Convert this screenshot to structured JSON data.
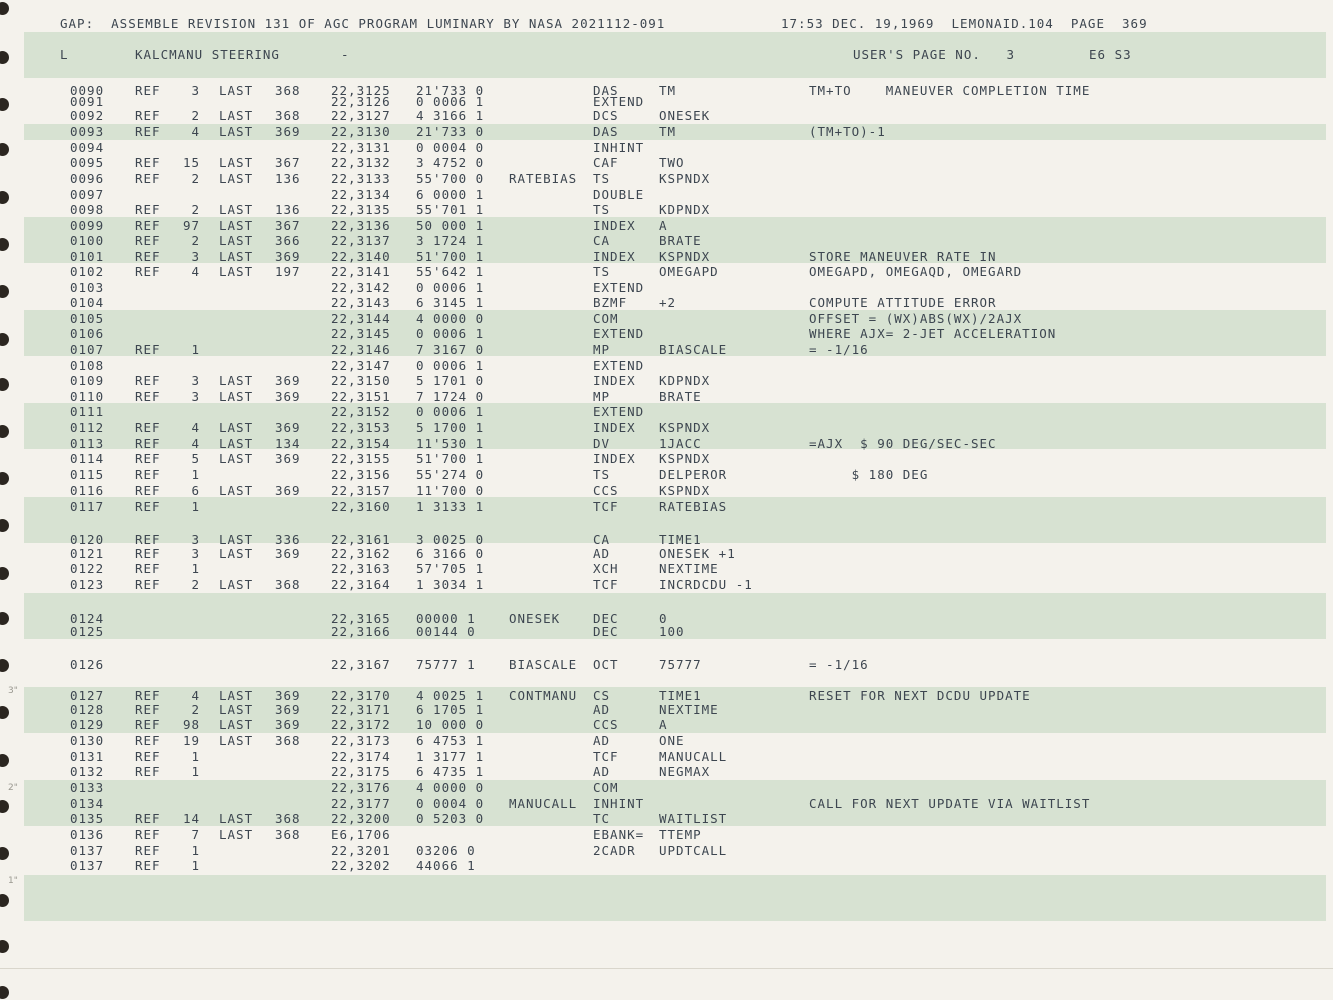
{
  "header": {
    "left": "GAP:  ASSEMBLE REVISION 131 OF AGC PROGRAM LUMINARY BY NASA 2021112-091",
    "right": "17:53 DEC. 19,1969  LEMONAID.104  PAGE  369"
  },
  "subheader": {
    "type": "L",
    "title": "KALCMANU STEERING",
    "dash": "-",
    "users_page": "USER'S PAGE NO.   3",
    "bank": "E6 S3"
  },
  "rows": [
    {
      "line": "0090",
      "ref": "REF",
      "refnum": "3",
      "last": "LAST",
      "lastpage": "368",
      "loc": "22,3125",
      "word": "21'733 0",
      "label": "",
      "op": "DAS",
      "operand": "TM",
      "comment": "TM+TO    MANEUVER COMPLETION TIME"
    },
    {
      "line": "0091",
      "ref": "",
      "refnum": "",
      "last": "",
      "lastpage": "",
      "loc": "22,3126",
      "word": "0 0006 1",
      "label": "",
      "op": "EXTEND",
      "operand": "",
      "comment": ""
    },
    {
      "line": "0092",
      "ref": "REF",
      "refnum": "2",
      "last": "LAST",
      "lastpage": "368",
      "loc": "22,3127",
      "word": "4 3166 1",
      "label": "",
      "op": "DCS",
      "operand": "ONESEK",
      "comment": ""
    },
    {
      "line": "0093",
      "ref": "REF",
      "refnum": "4",
      "last": "LAST",
      "lastpage": "369",
      "loc": "22,3130",
      "word": "21'733 0",
      "label": "",
      "op": "DAS",
      "operand": "TM",
      "comment": "(TM+TO)-1"
    },
    {
      "line": "0094",
      "ref": "",
      "refnum": "",
      "last": "",
      "lastpage": "",
      "loc": "22,3131",
      "word": "0 0004 0",
      "label": "",
      "op": "INHINT",
      "operand": "",
      "comment": ""
    },
    {
      "line": "0095",
      "ref": "REF",
      "refnum": "15",
      "last": "LAST",
      "lastpage": "367",
      "loc": "22,3132",
      "word": "3 4752 0",
      "label": "",
      "op": "CAF",
      "operand": "TWO",
      "comment": ""
    },
    {
      "line": "0096",
      "ref": "REF",
      "refnum": "2",
      "last": "LAST",
      "lastpage": "136",
      "loc": "22,3133",
      "word": "55'700 0",
      "label": "RATEBIAS",
      "op": "TS",
      "operand": "KSPNDX",
      "comment": ""
    },
    {
      "line": "0097",
      "ref": "",
      "refnum": "",
      "last": "",
      "lastpage": "",
      "loc": "22,3134",
      "word": "6 0000 1",
      "label": "",
      "op": "DOUBLE",
      "operand": "",
      "comment": ""
    },
    {
      "line": "0098",
      "ref": "REF",
      "refnum": "2",
      "last": "LAST",
      "lastpage": "136",
      "loc": "22,3135",
      "word": "55'701 1",
      "label": "",
      "op": "TS",
      "operand": "KDPNDX",
      "comment": ""
    },
    {
      "line": "0099",
      "ref": "REF",
      "refnum": "97",
      "last": "LAST",
      "lastpage": "367",
      "loc": "22,3136",
      "word": "50 000 1",
      "label": "",
      "op": "INDEX",
      "operand": "A",
      "comment": ""
    },
    {
      "line": "0100",
      "ref": "REF",
      "refnum": "2",
      "last": "LAST",
      "lastpage": "366",
      "loc": "22,3137",
      "word": "3 1724 1",
      "label": "",
      "op": "CA",
      "operand": "BRATE",
      "comment": ""
    },
    {
      "line": "0101",
      "ref": "REF",
      "refnum": "3",
      "last": "LAST",
      "lastpage": "369",
      "loc": "22,3140",
      "word": "51'700 1",
      "label": "",
      "op": "INDEX",
      "operand": "KSPNDX",
      "comment": "STORE MANEUVER RATE IN"
    },
    {
      "line": "0102",
      "ref": "REF",
      "refnum": "4",
      "last": "LAST",
      "lastpage": "197",
      "loc": "22,3141",
      "word": "55'642 1",
      "label": "",
      "op": "TS",
      "operand": "OMEGAPD",
      "comment": "OMEGAPD, OMEGAQD, OMEGARD"
    },
    {
      "line": "0103",
      "ref": "",
      "refnum": "",
      "last": "",
      "lastpage": "",
      "loc": "22,3142",
      "word": "0 0006 1",
      "label": "",
      "op": "EXTEND",
      "operand": "",
      "comment": ""
    },
    {
      "line": "0104",
      "ref": "",
      "refnum": "",
      "last": "",
      "lastpage": "",
      "loc": "22,3143",
      "word": "6 3145 1",
      "label": "",
      "op": "BZMF",
      "operand": "+2",
      "comment": "COMPUTE ATTITUDE ERROR"
    },
    {
      "line": "0105",
      "ref": "",
      "refnum": "",
      "last": "",
      "lastpage": "",
      "loc": "22,3144",
      "word": "4 0000 0",
      "label": "",
      "op": "COM",
      "operand": "",
      "comment": "OFFSET = (WX)ABS(WX)/2AJX"
    },
    {
      "line": "0106",
      "ref": "",
      "refnum": "",
      "last": "",
      "lastpage": "",
      "loc": "22,3145",
      "word": "0 0006 1",
      "label": "",
      "op": "EXTEND",
      "operand": "",
      "comment": "WHERE AJX= 2-JET ACCELERATION"
    },
    {
      "line": "0107",
      "ref": "REF",
      "refnum": "1",
      "last": "",
      "lastpage": "",
      "loc": "22,3146",
      "word": "7 3167 0",
      "label": "",
      "op": "MP",
      "operand": "BIASCALE",
      "comment": "= -1/16"
    },
    {
      "line": "0108",
      "ref": "",
      "refnum": "",
      "last": "",
      "lastpage": "",
      "loc": "22,3147",
      "word": "0 0006 1",
      "label": "",
      "op": "EXTEND",
      "operand": "",
      "comment": ""
    },
    {
      "line": "0109",
      "ref": "REF",
      "refnum": "3",
      "last": "LAST",
      "lastpage": "369",
      "loc": "22,3150",
      "word": "5 1701 0",
      "label": "",
      "op": "INDEX",
      "operand": "KDPNDX",
      "comment": ""
    },
    {
      "line": "0110",
      "ref": "REF",
      "refnum": "3",
      "last": "LAST",
      "lastpage": "369",
      "loc": "22,3151",
      "word": "7 1724 0",
      "label": "",
      "op": "MP",
      "operand": "BRATE",
      "comment": ""
    },
    {
      "line": "0111",
      "ref": "",
      "refnum": "",
      "last": "",
      "lastpage": "",
      "loc": "22,3152",
      "word": "0 0006 1",
      "label": "",
      "op": "EXTEND",
      "operand": "",
      "comment": ""
    },
    {
      "line": "0112",
      "ref": "REF",
      "refnum": "4",
      "last": "LAST",
      "lastpage": "369",
      "loc": "22,3153",
      "word": "5 1700 1",
      "label": "",
      "op": "INDEX",
      "operand": "KSPNDX",
      "comment": ""
    },
    {
      "line": "0113",
      "ref": "REF",
      "refnum": "4",
      "last": "LAST",
      "lastpage": "134",
      "loc": "22,3154",
      "word": "11'530 1",
      "label": "",
      "op": "DV",
      "operand": "1JACC",
      "comment": "=AJX  $ 90 DEG/SEC-SEC"
    },
    {
      "line": "0114",
      "ref": "REF",
      "refnum": "5",
      "last": "LAST",
      "lastpage": "369",
      "loc": "22,3155",
      "word": "51'700 1",
      "label": "",
      "op": "INDEX",
      "operand": "KSPNDX",
      "comment": ""
    },
    {
      "line": "0115",
      "ref": "REF",
      "refnum": "1",
      "last": "",
      "lastpage": "",
      "loc": "22,3156",
      "word": "55'274 0",
      "label": "",
      "op": "TS",
      "operand": "DELPEROR",
      "comment": "     $ 180 DEG"
    },
    {
      "line": "0116",
      "ref": "REF",
      "refnum": "6",
      "last": "LAST",
      "lastpage": "369",
      "loc": "22,3157",
      "word": "11'700 0",
      "label": "",
      "op": "CCS",
      "operand": "KSPNDX",
      "comment": ""
    },
    {
      "line": "0117",
      "ref": "REF",
      "refnum": "1",
      "last": "",
      "lastpage": "",
      "loc": "22,3160",
      "word": "1 3133 1",
      "label": "",
      "op": "TCF",
      "operand": "RATEBIAS",
      "comment": ""
    },
    {
      "line": "0120",
      "ref": "REF",
      "refnum": "3",
      "last": "LAST",
      "lastpage": "336",
      "loc": "22,3161",
      "word": "3 0025 0",
      "label": "",
      "op": "CA",
      "operand": "TIME1",
      "comment": ""
    },
    {
      "line": "0121",
      "ref": "REF",
      "refnum": "3",
      "last": "LAST",
      "lastpage": "369",
      "loc": "22,3162",
      "word": "6 3166 0",
      "label": "",
      "op": "AD",
      "operand": "ONESEK +1",
      "comment": ""
    },
    {
      "line": "0122",
      "ref": "REF",
      "refnum": "1",
      "last": "",
      "lastpage": "",
      "loc": "22,3163",
      "word": "57'705 1",
      "label": "",
      "op": "XCH",
      "operand": "NEXTIME",
      "comment": ""
    },
    {
      "line": "0123",
      "ref": "REF",
      "refnum": "2",
      "last": "LAST",
      "lastpage": "368",
      "loc": "22,3164",
      "word": "1 3034 1",
      "label": "",
      "op": "TCF",
      "operand": "INCRDCDU -1",
      "comment": ""
    },
    {
      "line": "0124",
      "ref": "",
      "refnum": "",
      "last": "",
      "lastpage": "",
      "loc": "22,3165",
      "word": "00000 1",
      "label": "ONESEK",
      "op": "DEC",
      "operand": "0",
      "comment": ""
    },
    {
      "line": "0125",
      "ref": "",
      "refnum": "",
      "last": "",
      "lastpage": "",
      "loc": "22,3166",
      "word": "00144 0",
      "label": "",
      "op": "DEC",
      "operand": "100",
      "comment": ""
    },
    {
      "line": "0126",
      "ref": "",
      "refnum": "",
      "last": "",
      "lastpage": "",
      "loc": "22,3167",
      "word": "75777 1",
      "label": "BIASCALE",
      "op": "OCT",
      "operand": "75777",
      "comment": "= -1/16"
    },
    {
      "line": "0127",
      "ref": "REF",
      "refnum": "4",
      "last": "LAST",
      "lastpage": "369",
      "loc": "22,3170",
      "word": "4 0025 1",
      "label": "CONTMANU",
      "op": "CS",
      "operand": "TIME1",
      "comment": "RESET FOR NEXT DCDU UPDATE"
    },
    {
      "line": "0128",
      "ref": "REF",
      "refnum": "2",
      "last": "LAST",
      "lastpage": "369",
      "loc": "22,3171",
      "word": "6 1705 1",
      "label": "",
      "op": "AD",
      "operand": "NEXTIME",
      "comment": ""
    },
    {
      "line": "0129",
      "ref": "REF",
      "refnum": "98",
      "last": "LAST",
      "lastpage": "369",
      "loc": "22,3172",
      "word": "10 000 0",
      "label": "",
      "op": "CCS",
      "operand": "A",
      "comment": ""
    },
    {
      "line": "0130",
      "ref": "REF",
      "refnum": "19",
      "last": "LAST",
      "lastpage": "368",
      "loc": "22,3173",
      "word": "6 4753 1",
      "label": "",
      "op": "AD",
      "operand": "ONE",
      "comment": ""
    },
    {
      "line": "0131",
      "ref": "REF",
      "refnum": "1",
      "last": "",
      "lastpage": "",
      "loc": "22,3174",
      "word": "1 3177 1",
      "label": "",
      "op": "TCF",
      "operand": "MANUCALL",
      "comment": ""
    },
    {
      "line": "0132",
      "ref": "REF",
      "refnum": "1",
      "last": "",
      "lastpage": "",
      "loc": "22,3175",
      "word": "6 4735 1",
      "label": "",
      "op": "AD",
      "operand": "NEGMAX",
      "comment": ""
    },
    {
      "line": "0133",
      "ref": "",
      "refnum": "",
      "last": "",
      "lastpage": "",
      "loc": "22,3176",
      "word": "4 0000 0",
      "label": "",
      "op": "COM",
      "operand": "",
      "comment": ""
    },
    {
      "line": "0134",
      "ref": "",
      "refnum": "",
      "last": "",
      "lastpage": "",
      "loc": "22,3177",
      "word": "0 0004 0",
      "label": "MANUCALL",
      "op": "INHINT",
      "operand": "",
      "comment": "CALL FOR NEXT UPDATE VIA WAITLIST"
    },
    {
      "line": "0135",
      "ref": "REF",
      "refnum": "14",
      "last": "LAST",
      "lastpage": "368",
      "loc": "22,3200",
      "word": "0 5203 0",
      "label": "",
      "op": "TC",
      "operand": "WAITLIST",
      "comment": ""
    },
    {
      "line": "0136",
      "ref": "REF",
      "refnum": "7",
      "last": "LAST",
      "lastpage": "368",
      "loc": "E6,1706",
      "word": "",
      "label": "",
      "op": "EBANK=",
      "operand": "TTEMP",
      "comment": ""
    },
    {
      "line": "0137",
      "ref": "REF",
      "refnum": "1",
      "last": "",
      "lastpage": "",
      "loc": "22,3201",
      "word": "03206 0",
      "label": "",
      "op": "2CADR",
      "operand": "UPDTCALL",
      "comment": ""
    },
    {
      "line": "0137",
      "ref": "REF",
      "refnum": "1",
      "last": "",
      "lastpage": "",
      "loc": "22,3202",
      "word": "44066 1",
      "label": "",
      "op": "",
      "operand": "",
      "comment": ""
    }
  ],
  "margin_marks": [
    "3\"",
    "2\"",
    "1\""
  ]
}
